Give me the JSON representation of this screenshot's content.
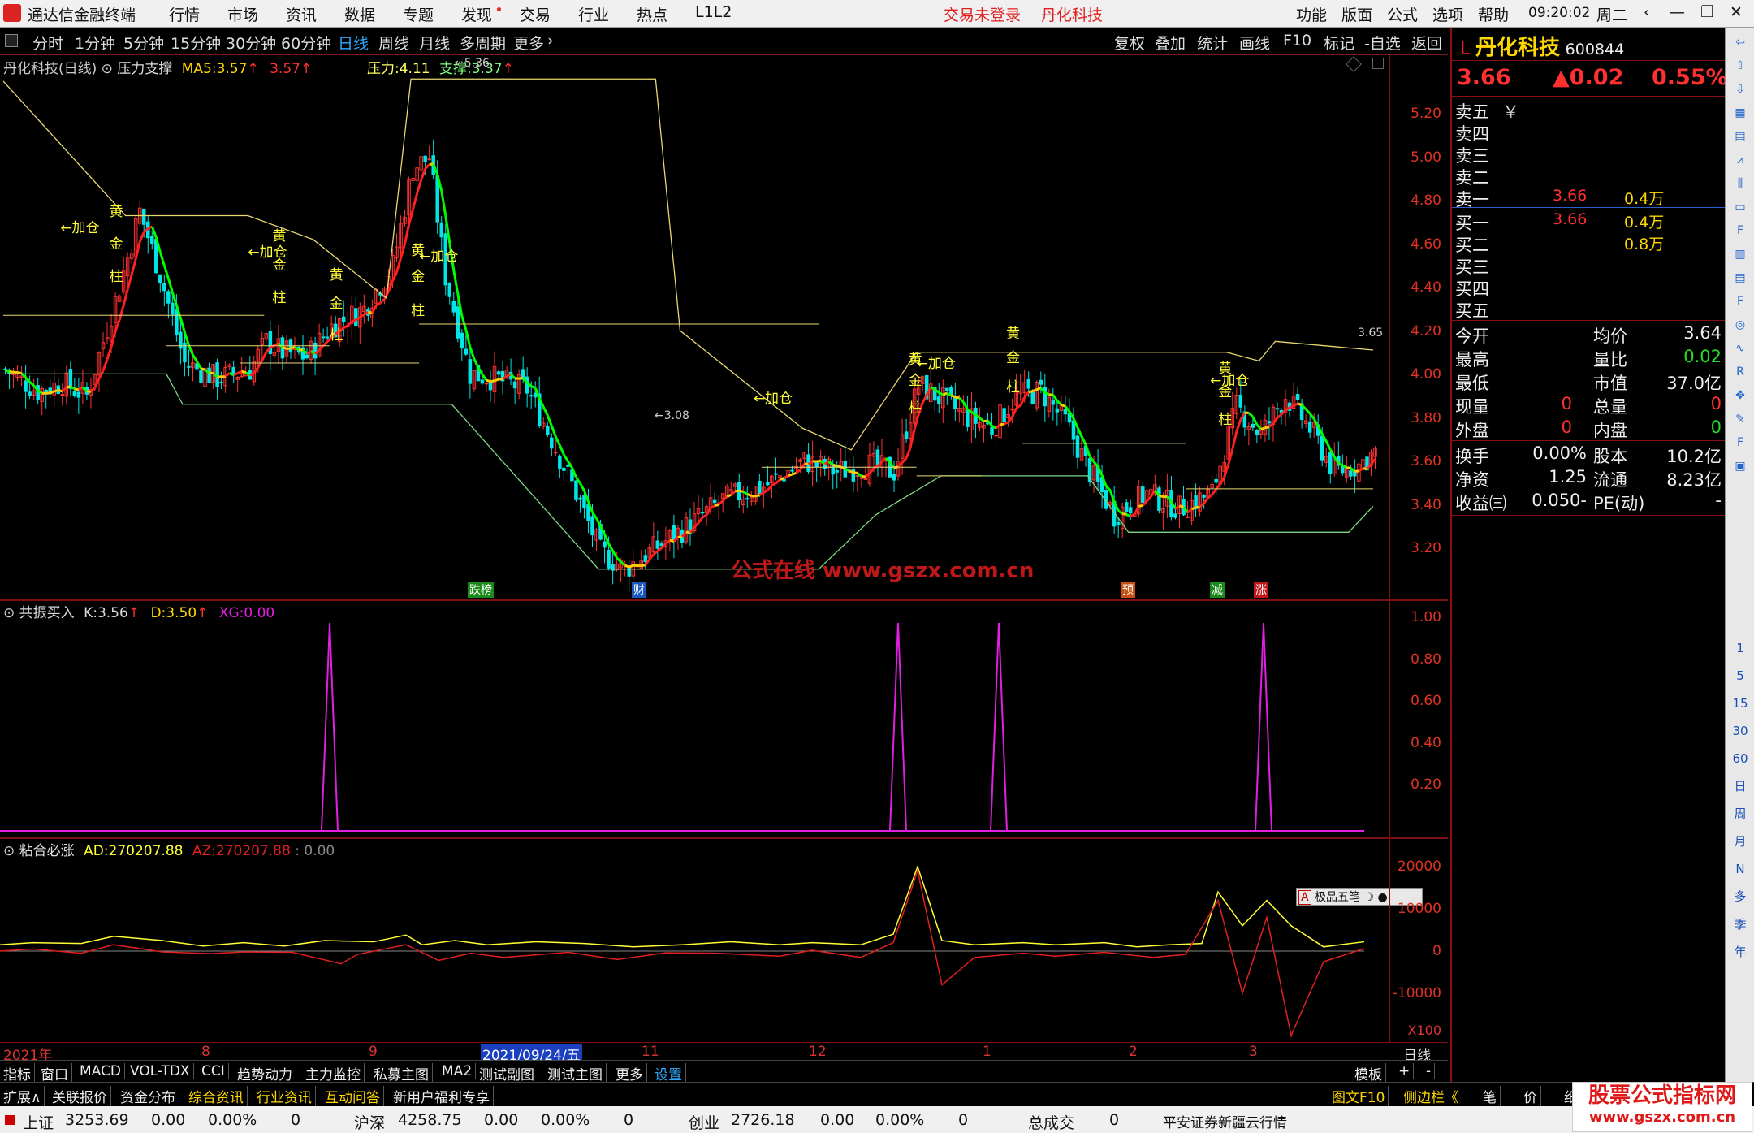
{
  "menubar": {
    "app_title": "通达信金融终端",
    "menus": [
      "行情",
      "市场",
      "资讯",
      "数据",
      "专题",
      "发现",
      "交易",
      "行业",
      "热点",
      "L1L2"
    ],
    "login_status": "交易未登录",
    "stock_name": "丹化科技",
    "right_menus": [
      "功能",
      "版面",
      "公式",
      "选项",
      "帮助"
    ],
    "time": "09:20:02",
    "weekday": "周二"
  },
  "timeframes": [
    "分时",
    "1分钟",
    "5分钟",
    "15分钟",
    "30分钟",
    "60分钟",
    "日线",
    "周线",
    "月线",
    "多周期",
    "更多"
  ],
  "active_timeframe": "日线",
  "toolbar_right": [
    "复权",
    "叠加",
    "统计",
    "画线",
    "F10",
    "标记",
    "-自选",
    "返回"
  ],
  "main_pane": {
    "title": "丹化科技(日线)",
    "indicator": "压力支撑",
    "ma5_label": "MA5:",
    "ma5_value": "3.57",
    "ma5_prev": "3.57",
    "pressure_label": "压力:",
    "pressure_value": "4.11",
    "support_label": "支撑:",
    "support_value": "3.37",
    "peak_label": "5.36",
    "low_label": "3.08",
    "last_label": "3.65",
    "watermark": "公式在线  www.gszx.com.cn",
    "y_ticks": [
      "5.20",
      "5.00",
      "4.80",
      "4.60",
      "4.40",
      "4.20",
      "4.00",
      "3.80",
      "3.60",
      "3.40",
      "3.20"
    ],
    "events": [
      "跌榜",
      "财",
      "预",
      "减",
      "涨"
    ]
  },
  "signal_words": {
    "yellow": "黄",
    "add": "←加仓",
    "gold": "金",
    "pillar": "柱"
  },
  "pane2": {
    "title": "共振买入",
    "k_label": "K:",
    "k_value": "3.56",
    "d_label": "D:",
    "d_value": "3.50",
    "xg_label": "XG:",
    "xg_value": "0.00",
    "y_ticks": [
      "1.00",
      "0.80",
      "0.60",
      "0.40",
      "0.20"
    ]
  },
  "pane3": {
    "title": "粘合必涨",
    "ad_label": "AD:",
    "ad_value": "270207.88",
    "az_label": "AZ:",
    "az_value": "270207.88",
    "extra": ": 0.00",
    "y_ticks": [
      "20000",
      "10000",
      "0",
      "-10000"
    ],
    "scale": "X100",
    "widget": "极品五笔"
  },
  "datebar": {
    "labels": [
      "2021年",
      "8",
      "9",
      "2021/09/24/五",
      "11",
      "12",
      "1",
      "2",
      "3"
    ],
    "period": "日线"
  },
  "tabs1": [
    "指标",
    "窗口",
    "MACD",
    "VOL-TDX",
    "CCI",
    "趋势动力",
    "主力监控",
    "私募主图",
    "MA2",
    "测试副图",
    "测试主图",
    "更多",
    "设置"
  ],
  "tabs1_right": [
    "模板",
    "+",
    "-"
  ],
  "tabs2": [
    "扩展∧",
    "关联报价",
    "资金分布",
    "综合资讯",
    "行业资讯",
    "互动问答",
    "新用户福利专享"
  ],
  "tabs2_right": [
    "图文F10",
    "侧边栏《",
    "笔",
    "价",
    "细",
    "势"
  ],
  "status": {
    "sh_name": "上证",
    "sh_val": "3253.69",
    "sh_chg": "0.00",
    "sh_pct": "0.00%",
    "sh_vol": "0",
    "hs_name": "沪深",
    "hs_val": "4258.75",
    "hs_chg": "0.00",
    "hs_pct": "0.00%",
    "hs_vol": "0",
    "cy_name": "创业",
    "cy_val": "2726.18",
    "cy_chg": "0.00",
    "cy_pct": "0.00%",
    "cy_vol": "0",
    "total_label": "总成交",
    "total_val": "0",
    "broker": "平安证券新疆云行情",
    "brand": "股票公式指标网",
    "brand_url": "www.gszx.com.cn"
  },
  "quote": {
    "prefix": "L",
    "name": "丹化科技",
    "code": "600844",
    "price": "3.66",
    "change": "▲0.02",
    "pct": "0.55%",
    "asks": [
      {
        "l": "卖五",
        "p": "",
        "v": ""
      },
      {
        "l": "卖四",
        "p": "",
        "v": ""
      },
      {
        "l": "卖三",
        "p": "",
        "v": ""
      },
      {
        "l": "卖二",
        "p": "",
        "v": ""
      },
      {
        "l": "卖一",
        "p": "3.66",
        "v": "0.4万"
      }
    ],
    "ask5_mark": "￥",
    "bids": [
      {
        "l": "买一",
        "p": "3.66",
        "v": "0.4万"
      },
      {
        "l": "买二",
        "p": "",
        "v": "0.8万"
      },
      {
        "l": "买三",
        "p": "",
        "v": ""
      },
      {
        "l": "买四",
        "p": "",
        "v": ""
      },
      {
        "l": "买五",
        "p": "",
        "v": ""
      }
    ],
    "stats": [
      [
        "今开",
        "",
        "均价",
        "3.64"
      ],
      [
        "最高",
        "",
        "量比",
        "0.02"
      ],
      [
        "最低",
        "",
        "市值",
        "37.0亿"
      ],
      [
        "现量",
        "0",
        "总量",
        "0"
      ],
      [
        "外盘",
        "0",
        "内盘",
        "0"
      ]
    ],
    "stats2": [
      [
        "换手",
        "0.00%",
        "股本",
        "10.2亿"
      ],
      [
        "净资",
        "1.25",
        "流通",
        "8.23亿"
      ],
      [
        "收益㈢",
        "-0.050",
        "PE(动)",
        "-"
      ]
    ]
  },
  "sidebar": [
    "1",
    "5",
    "15",
    "30",
    "60",
    "日",
    "周",
    "月",
    "N",
    "多",
    "季",
    "年"
  ]
}
